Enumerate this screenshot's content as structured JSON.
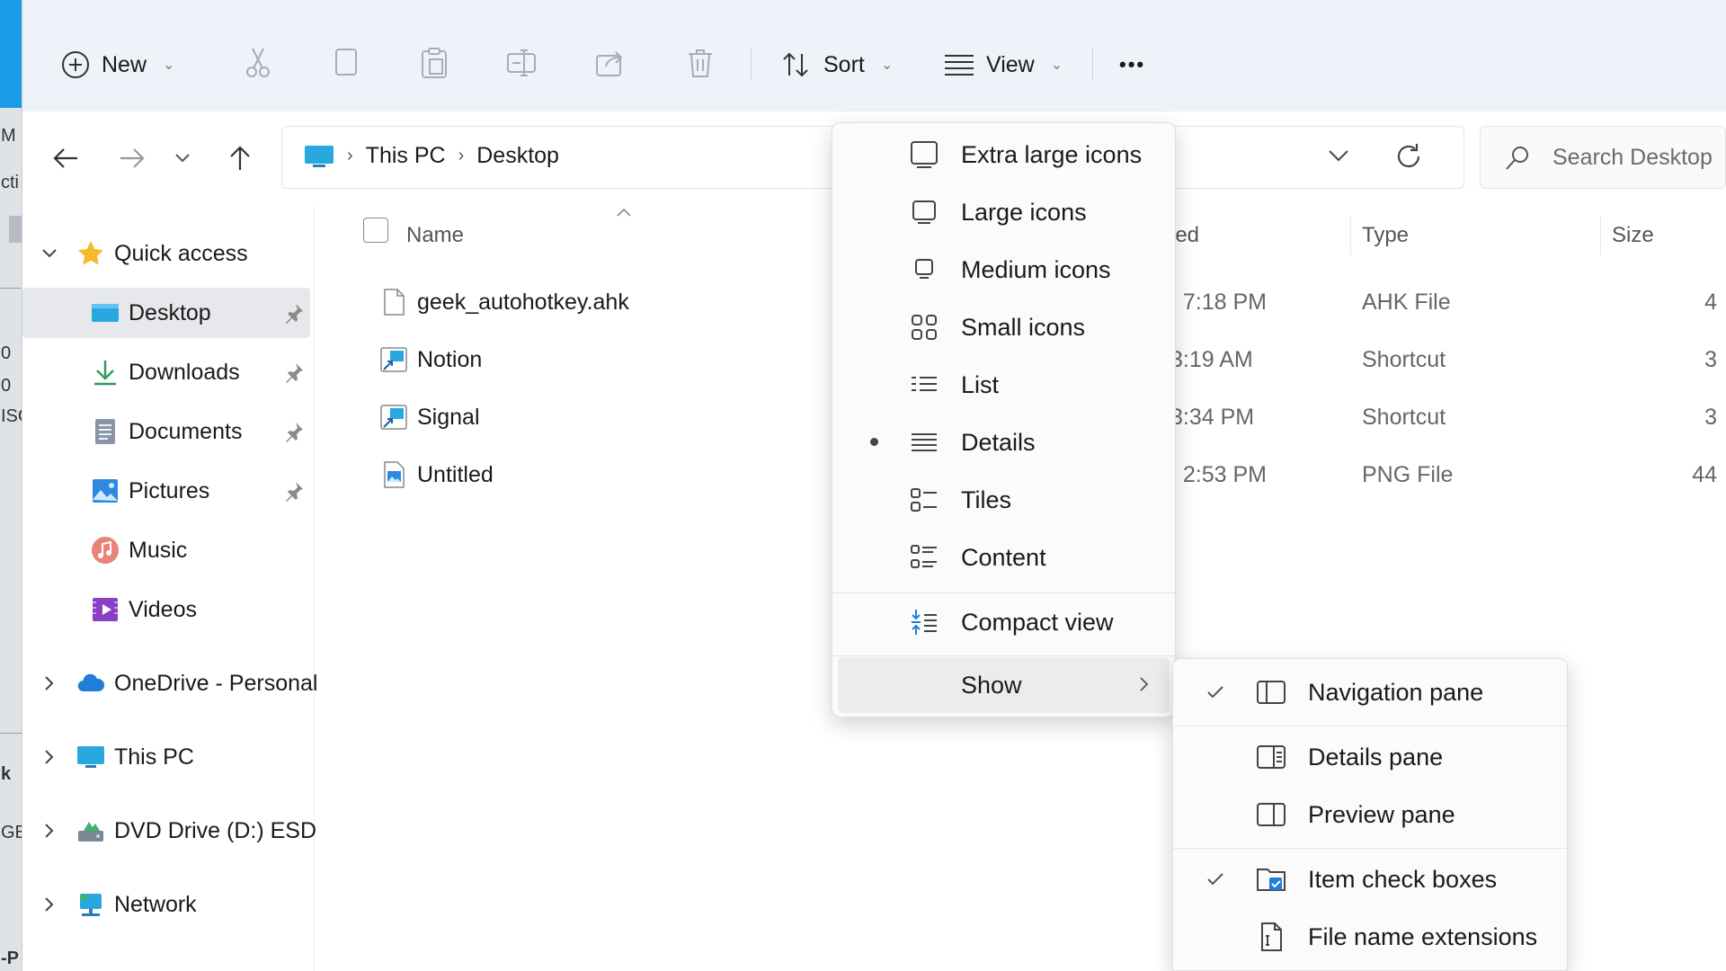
{
  "left_strip": {
    "fragments": [
      "M",
      "cti",
      "0",
      "0",
      "ISC",
      "k",
      "GB",
      "-P"
    ]
  },
  "toolbar": {
    "new_label": "New",
    "sort_label": "Sort",
    "view_label": "View",
    "more_label": "•••"
  },
  "address": {
    "crumbs": [
      "This PC",
      "Desktop"
    ],
    "search_placeholder": "Search Desktop"
  },
  "sidebar": {
    "quick_access": "Quick access",
    "items": [
      {
        "label": "Desktop",
        "pinned": true
      },
      {
        "label": "Downloads",
        "pinned": true
      },
      {
        "label": "Documents",
        "pinned": true
      },
      {
        "label": "Pictures",
        "pinned": true
      },
      {
        "label": "Music"
      },
      {
        "label": "Videos"
      }
    ],
    "roots": [
      {
        "label": "OneDrive - Personal"
      },
      {
        "label": "This PC"
      },
      {
        "label": "DVD Drive (D:) ESD-"
      },
      {
        "label": "Network"
      }
    ]
  },
  "files": {
    "columns": {
      "name": "Name",
      "modified": "ied",
      "type": "Type",
      "size": "Size"
    },
    "rows": [
      {
        "name": "geek_autohotkey.ahk",
        "date": ": 7:18 PM",
        "type": "AHK File",
        "size": "4"
      },
      {
        "name": "Notion",
        "date": "3:19 AM",
        "type": "Shortcut",
        "size": "3"
      },
      {
        "name": "Signal",
        "date": "3:34 PM",
        "type": "Shortcut",
        "size": "3"
      },
      {
        "name": "Untitled",
        "date": ": 2:53 PM",
        "type": "PNG File",
        "size": "44"
      }
    ]
  },
  "view_menu": {
    "items": [
      {
        "label": "Extra large icons"
      },
      {
        "label": "Large icons"
      },
      {
        "label": "Medium icons"
      },
      {
        "label": "Small icons"
      },
      {
        "label": "List"
      },
      {
        "label": "Details",
        "selected": true
      },
      {
        "label": "Tiles"
      },
      {
        "label": "Content"
      },
      {
        "label": "Compact view"
      },
      {
        "label": "Show"
      }
    ]
  },
  "show_menu": {
    "items": [
      {
        "label": "Navigation pane",
        "checked": true
      },
      {
        "label": "Details pane",
        "checked": false
      },
      {
        "label": "Preview pane",
        "checked": false
      },
      {
        "label": "Item check boxes",
        "checked": true
      },
      {
        "label": "File name extensions",
        "checked": false
      }
    ]
  },
  "colors": {
    "accent": "#1b9ce8",
    "toolbar_bg": "#eef3f9",
    "selected_bg": "#e6e8eb"
  }
}
